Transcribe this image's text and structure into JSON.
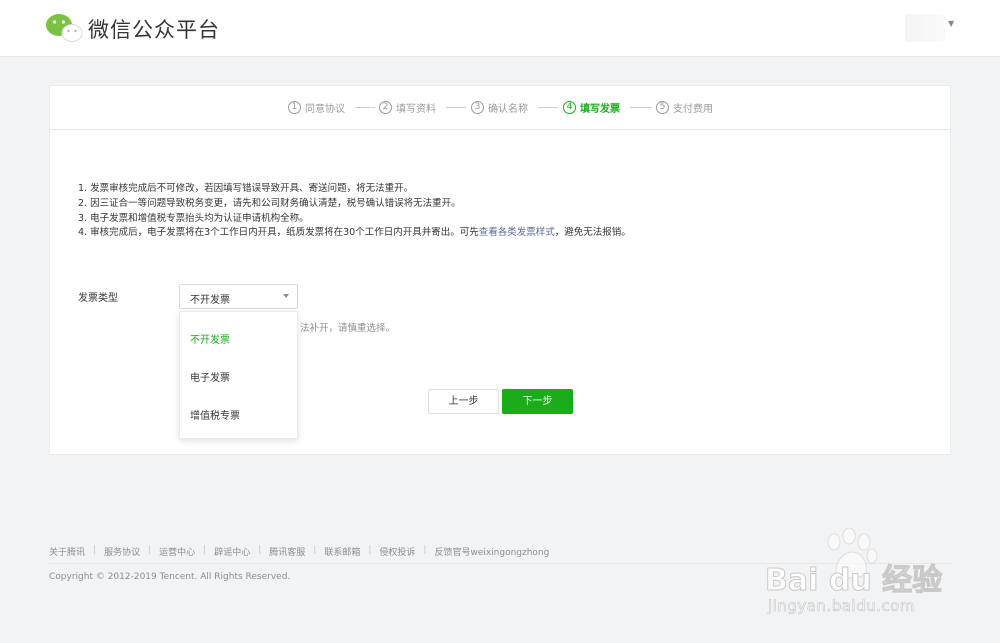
{
  "header": {
    "brand": "微信公众平台"
  },
  "steps": [
    {
      "num": "1",
      "label": "同意协议",
      "active": false
    },
    {
      "num": "2",
      "label": "填写资料",
      "active": false
    },
    {
      "num": "3",
      "label": "确认名称",
      "active": false
    },
    {
      "num": "4",
      "label": "填写发票",
      "active": true
    },
    {
      "num": "5",
      "label": "支付费用",
      "active": false
    }
  ],
  "notes": {
    "n1": "1. 发票审核完成后不可修改，若因填写错误导致开具、寄送问题，将无法重开。",
    "n2": "2. 因三证合一等问题导致税务变更，请先和公司财务确认清楚，税号确认错误将无法重开。",
    "n3": "3. 电子发票和增值税专票抬头均为认证申请机构全称。",
    "n4_before": "4. 审核完成后，电子发票将在3个工作日内开具，纸质发票将在30个工作日内开具并寄出。可先",
    "n4_link": "查看各类发票样式",
    "n4_after": "，避免无法报销。"
  },
  "form": {
    "label": "发票类型",
    "selected": "不开发票",
    "hint_visible": "法补开，请慎重选择。",
    "options": [
      "不开发票",
      "电子发票",
      "增值税专票"
    ]
  },
  "buttons": {
    "prev": "上一步",
    "next": "下一步"
  },
  "footer": {
    "links": [
      "关于腾讯",
      "服务协议",
      "运营中心",
      "辟谣中心",
      "腾讯客服",
      "联系邮箱",
      "侵权投诉",
      "反馈官号weixingongzhong"
    ],
    "copyright": "Copyright © 2012-2019 Tencent. All Rights Reserved."
  },
  "watermark": {
    "text": "Bai du 经验",
    "url": "jingyan.baidu.com"
  },
  "colors": {
    "accent": "#1aad19",
    "link": "#576b95"
  }
}
